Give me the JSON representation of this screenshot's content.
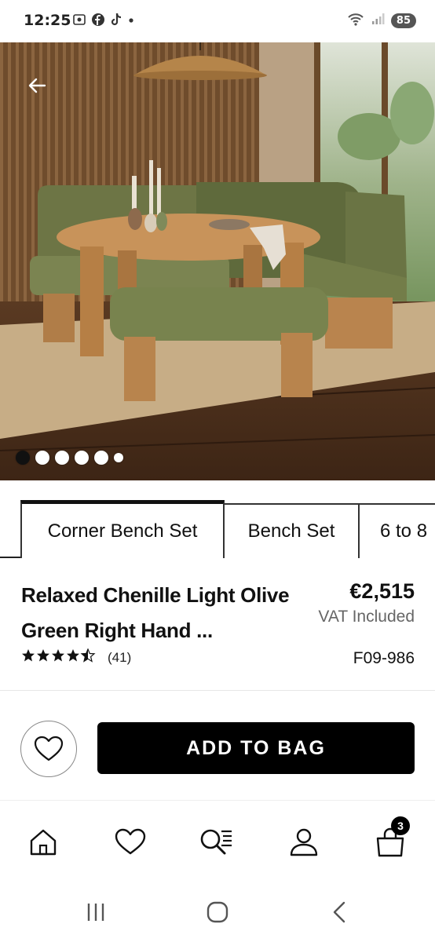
{
  "status_bar": {
    "time": "12:25",
    "battery": "85",
    "icons": [
      "screenshot-icon",
      "facebook-icon",
      "tiktok-icon",
      "dot-icon",
      "wifi-icon",
      "signal-icon"
    ]
  },
  "hero": {
    "alt_icons": [
      "back-arrow-icon"
    ],
    "image_count": 6,
    "active_index": 0
  },
  "tabs": [
    {
      "label": "Corner Bench Set",
      "active": true
    },
    {
      "label": "Bench Set",
      "active": false
    },
    {
      "label": "6 to 8",
      "active": false
    }
  ],
  "product": {
    "title": "Relaxed Chenille Light Olive Green Right Hand ...",
    "price": "€2,515",
    "vat": "VAT Included",
    "rating": 4.5,
    "rating_max": 5,
    "review_count": "(41)",
    "sku": "F09-986"
  },
  "actions": {
    "add_to_bag": "ADD TO BAG"
  },
  "bottom_nav": {
    "items": [
      "home-icon",
      "wishlist-icon",
      "search-icon",
      "account-icon",
      "bag-icon"
    ],
    "bag_count": "3"
  },
  "colors": {
    "accent": "#000000",
    "text": "#111111",
    "muted": "#666666"
  }
}
